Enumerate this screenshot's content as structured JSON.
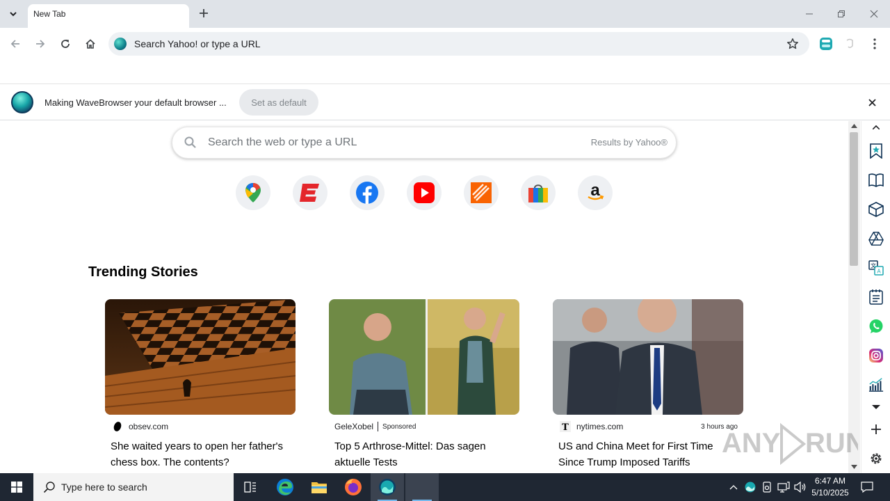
{
  "browser": {
    "tab_title": "New Tab",
    "omnibox_text": "Search Yahoo! or type a URL"
  },
  "infobar": {
    "message": "Making WaveBrowser your default browser ...",
    "set_default_label": "Set as default"
  },
  "newtab": {
    "search_placeholder": "Search the web or type a URL",
    "search_provider": "Results by Yahoo®",
    "shortcuts": [
      {
        "name": "Google Maps",
        "icon": "maps-pin-icon"
      },
      {
        "name": "ESPN",
        "icon": "espn-icon"
      },
      {
        "name": "Facebook",
        "icon": "facebook-icon"
      },
      {
        "name": "YouTube",
        "icon": "youtube-icon"
      },
      {
        "name": "The Home Depot",
        "icon": "home-depot-icon"
      },
      {
        "name": "Shopping",
        "icon": "shopping-bag-icon"
      },
      {
        "name": "Amazon",
        "icon": "amazon-icon"
      }
    ],
    "trending_title": "Trending Stories",
    "stories": [
      {
        "source": "obsev.com",
        "sponsored": "",
        "time": "",
        "headline": "She waited years to open her father's chess box. The contents?"
      },
      {
        "source": "GeleXobel",
        "sponsored": "Sponsored",
        "time": "",
        "headline": "Top 5 Arthrose-Mittel: Das sagen aktuelle Tests"
      },
      {
        "source": "nytimes.com",
        "sponsored": "",
        "time": "3 hours ago",
        "headline": "US and China Meet for First Time Since Trump Imposed Tariffs"
      }
    ]
  },
  "sidebar_icons": [
    "bookmark-star-icon",
    "reading-book-icon",
    "package-box-icon",
    "gdrive-icon",
    "translate-icon",
    "notes-list-icon",
    "whatsapp-icon",
    "instagram-icon",
    "stats-chart-icon",
    "chevron-down-icon",
    "add-icon",
    "settings-icon"
  ],
  "taskbar": {
    "search_placeholder": "Type here to search",
    "time": "6:47 AM",
    "date": "5/10/2025"
  },
  "watermark": "ANY RUN",
  "colors": {
    "accent_teal": "#1ea9b2",
    "taskbar_bg": "#1f2733",
    "tabstrip_bg": "#dfe3e8"
  }
}
